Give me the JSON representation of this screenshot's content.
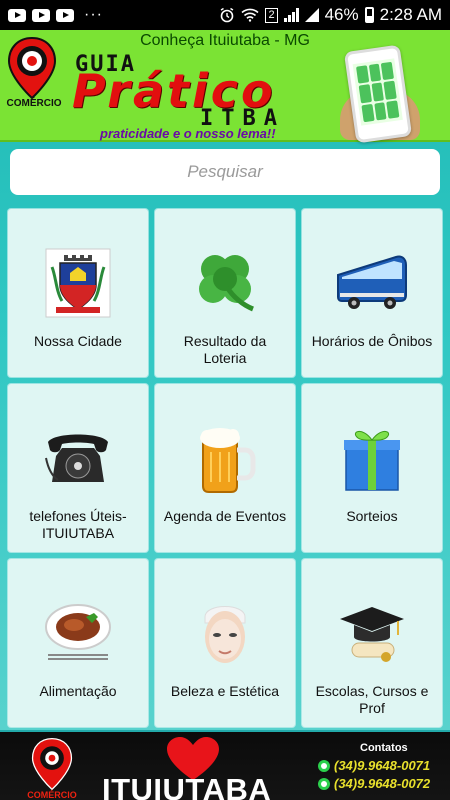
{
  "status_bar": {
    "dots": "···",
    "sim_badge": "2",
    "battery_percent": "46%",
    "time": "2:28 AM"
  },
  "banner": {
    "tagline_top": "Conheça Ituiutaba - MG",
    "logo_text": "GUIA PRÁTICO",
    "logo_commerce": "COMÉRCIO",
    "brand_guia": "GUIA",
    "brand_pratico": "Prático",
    "brand_itba": "ITBA",
    "brand_slogan": "praticidade e o nosso lema!!"
  },
  "search": {
    "placeholder": "Pesquisar"
  },
  "tiles": [
    {
      "label": "Nossa Cidade",
      "icon": "city-crest-icon"
    },
    {
      "label": "Resultado da Loteria",
      "icon": "clover-icon"
    },
    {
      "label": "Horários de Ônibos",
      "icon": "bus-icon"
    },
    {
      "label": "telefones Úteis- ITUIUTABA",
      "icon": "telephone-icon"
    },
    {
      "label": "Agenda de Eventos",
      "icon": "beer-mug-icon"
    },
    {
      "label": "Sorteios",
      "icon": "gift-box-icon"
    },
    {
      "label": "Alimentação",
      "icon": "food-plate-icon"
    },
    {
      "label": "Beleza e Estética",
      "icon": "face-mask-icon"
    },
    {
      "label": "Escolas, Cursos e Prof",
      "icon": "graduation-cap-icon"
    }
  ],
  "footer": {
    "logo_commerce": "COMÉRCIO",
    "city": "ITUIUTABA",
    "contacts_title": "Contatos",
    "phones": [
      "(34)9.9648-0071",
      "(34)9.9648-0072"
    ]
  },
  "colors": {
    "background": "#2fc7c3",
    "tile_background": "#dff6f3",
    "banner_green": "#7be334",
    "brand_red": "#e20f0f",
    "phone_yellow": "#e8e02c"
  }
}
